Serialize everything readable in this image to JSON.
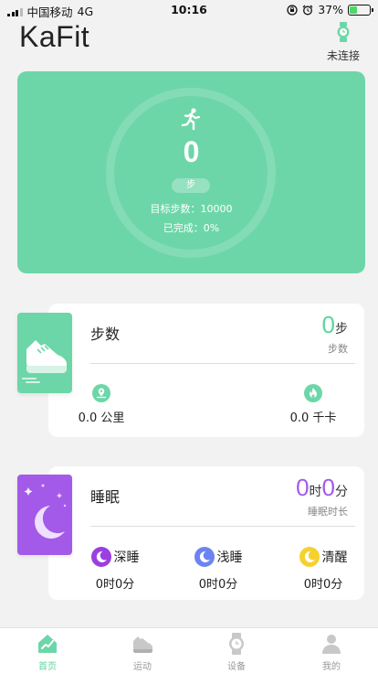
{
  "status_bar": {
    "carrier": "中国移动",
    "network": "4G",
    "time": "10:16",
    "battery": "37%",
    "battery_level": 0.37
  },
  "header": {
    "title": "KaFit",
    "connection_label": "未连接"
  },
  "hero": {
    "steps": "0",
    "unit": "步",
    "goal": "目标步数：10000",
    "completion": "已完成：0%"
  },
  "steps_card": {
    "title": "步数",
    "value": "0",
    "value_unit": "步",
    "subtitle": "步数",
    "distance": "0.0 公里",
    "calories": "0.0 千卡"
  },
  "sleep_card": {
    "title": "睡眠",
    "hours": "0",
    "hours_unit": "时",
    "minutes": "0",
    "minutes_unit": "分",
    "subtitle": "睡眠时长",
    "deep_label": "深睡",
    "deep_time": "0时0分",
    "light_label": "浅睡",
    "light_time": "0时0分",
    "awake_label": "清醒",
    "awake_time": "0时0分"
  },
  "tabs": [
    {
      "label": "首页",
      "icon": "home-chart-icon",
      "active": true
    },
    {
      "label": "运动",
      "icon": "sneaker-icon",
      "active": false
    },
    {
      "label": "设备",
      "icon": "watch-icon",
      "active": false
    },
    {
      "label": "我的",
      "icon": "person-icon",
      "active": false
    }
  ],
  "colors": {
    "accent_green": "#6dd6a8",
    "sleep_purple": "#a45ae8",
    "deep_sleep": "#9b3fe0",
    "light_sleep": "#6d83f2",
    "awake": "#f5d130",
    "background": "#f2f2f2"
  }
}
